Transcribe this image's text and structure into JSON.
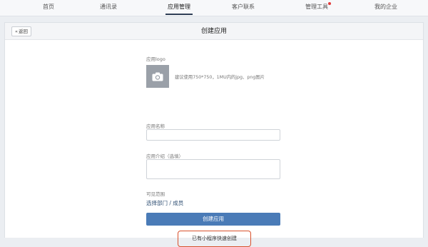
{
  "nav": {
    "items": [
      {
        "label": "首页"
      },
      {
        "label": "通讯录"
      },
      {
        "label": "应用管理"
      },
      {
        "label": "客户联系"
      },
      {
        "label": "管理工具"
      },
      {
        "label": "我的企业"
      }
    ],
    "active_index": 2
  },
  "header": {
    "back_label": "返回",
    "title": "创建应用"
  },
  "form": {
    "logo_label": "应用logo",
    "logo_hint": "建议使用750*750，1MU内的jpg、png图片",
    "name_label": "应用名称",
    "name_value": "",
    "intro_label": "应用介绍（选填）",
    "intro_value": "",
    "scope_label": "可见范围",
    "scope_link": "选择部门 / 成员",
    "submit_label": "创建应用",
    "quick_create_label": "已有小程序快速创建"
  },
  "colors": {
    "primary": "#4a7bb7",
    "highlight_border": "#d9512c",
    "notify_dot": "#e23b3b"
  }
}
